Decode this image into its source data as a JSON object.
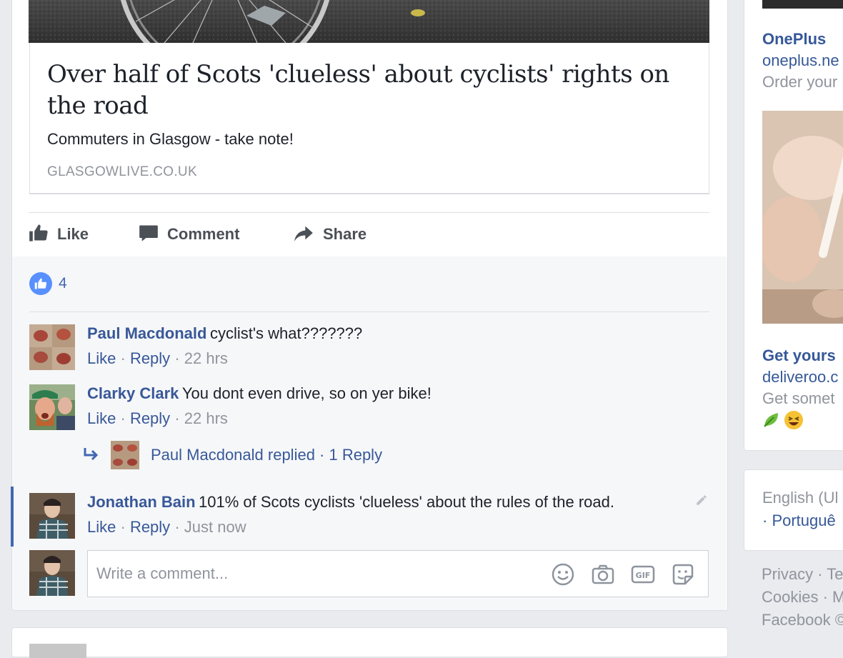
{
  "post": {
    "link": {
      "title": "Over half of Scots 'clueless' about cyclists' rights on the road",
      "description": "Commuters in Glasgow - take note!",
      "domain": "GLASGOWLIVE.CO.UK"
    },
    "actions": {
      "like": "Like",
      "comment": "Comment",
      "share": "Share"
    },
    "reactions": {
      "count": "4"
    }
  },
  "comments": [
    {
      "author": "Paul Macdonald",
      "text": "cyclist's what???????",
      "like": "Like",
      "reply": "Reply",
      "sep": "·",
      "time": "22 hrs"
    },
    {
      "author": "Clarky Clark",
      "text": "You dont even drive, so on yer bike!",
      "like": "Like",
      "reply": "Reply",
      "sep": "·",
      "time": "22 hrs",
      "replies_summary": "Paul Macdonald replied · 1 Reply"
    },
    {
      "author": "Jonathan Bain",
      "text": "101% of Scots cyclists 'clueless' about the rules of the road.",
      "like": "Like",
      "reply": "Reply",
      "sep": "·",
      "time": "Just now"
    }
  ],
  "composer": {
    "placeholder": "Write a comment...",
    "icons": [
      "emoji-icon",
      "camera-icon",
      "gif-icon",
      "sticker-icon"
    ]
  },
  "right_rail": {
    "ads": [
      {
        "title": "OnePlus",
        "url": "oneplus.ne",
        "desc": "Order your"
      },
      {
        "title": "Get yours",
        "url": "deliveroo.c",
        "desc": "Get somet"
      }
    ],
    "languages": {
      "current": "English (Ul",
      "other": "· Portuguê"
    },
    "footer": {
      "line1": "Privacy · Te",
      "line2": "Cookies · M",
      "line3": "Facebook ©"
    }
  },
  "colors": {
    "link_blue": "#385898",
    "accent_blue": "#4267b2",
    "reaction_blue": "#5890ff",
    "meta_gray": "#90949c",
    "page_bg": "#e9ebee"
  }
}
